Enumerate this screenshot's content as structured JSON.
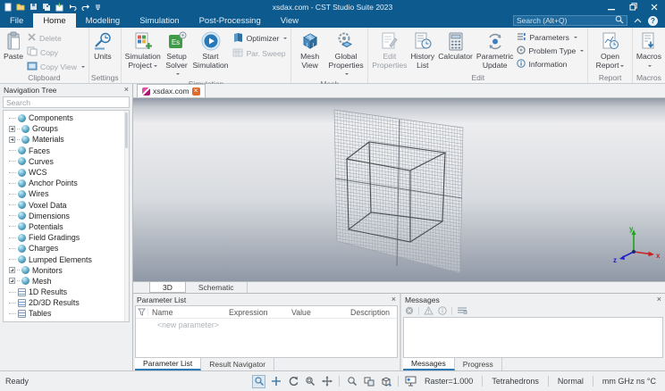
{
  "colors": {
    "titlebar_bg": "#0d5a8e",
    "ribbon_bg": "#f4f4f5",
    "accent_blue": "#2a7ab8",
    "active_tab_underline": "#2a7ab8",
    "axis_x": "#cc2020",
    "axis_y": "#18a818",
    "axis_z": "#2020cc",
    "doc_icon_pink": "#c4137f",
    "tab_close_orange": "#e06a2b"
  },
  "icons": {
    "close": "×",
    "help": "?",
    "solver_glyph": "Es"
  },
  "titlebar": {
    "title": "xsdax.com - CST Studio Suite 2023",
    "search_placeholder": "Search (Alt+Q)"
  },
  "menu": {
    "items": [
      {
        "label": "File"
      },
      {
        "label": "Home"
      },
      {
        "label": "Modeling"
      },
      {
        "label": "Simulation"
      },
      {
        "label": "Post-Processing"
      },
      {
        "label": "View"
      }
    ]
  },
  "ribbon": {
    "clipboard": {
      "label": "Clipboard",
      "paste": "Paste",
      "delete": "Delete",
      "copy": "Copy",
      "copy_view": "Copy View"
    },
    "settings": {
      "label": "Settings",
      "units": "Units"
    },
    "simulation": {
      "label": "Simulation",
      "project": "Simulation Project",
      "solver": "Setup Solver",
      "start": "Start Simulation",
      "optimizer": "Optimizer",
      "par_sweep": "Par. Sweep"
    },
    "mesh": {
      "label": "Mesh",
      "mesh_view": "Mesh View",
      "global_properties": "Global Properties"
    },
    "edit": {
      "label": "Edit",
      "edit_properties": "Edit Properties",
      "history_list": "History List",
      "calculator": "Calculator",
      "parametric_update": "Parametric Update",
      "parameters": "Parameters",
      "problem_type": "Problem Type",
      "information": "Information"
    },
    "report": {
      "label": "Report",
      "open_report": "Open Report"
    },
    "macros": {
      "label": "Macros",
      "macros": "Macros"
    }
  },
  "nav_tree": {
    "title": "Navigation Tree",
    "search_placeholder": "Search",
    "items": [
      {
        "label": "Components",
        "expandable": false
      },
      {
        "label": "Groups",
        "expandable": true
      },
      {
        "label": "Materials",
        "expandable": true
      },
      {
        "label": "Faces",
        "expandable": false
      },
      {
        "label": "Curves",
        "expandable": false
      },
      {
        "label": "WCS",
        "expandable": false
      },
      {
        "label": "Anchor Points",
        "expandable": false
      },
      {
        "label": "Wires",
        "expandable": false
      },
      {
        "label": "Voxel Data",
        "expandable": false
      },
      {
        "label": "Dimensions",
        "expandable": false
      },
      {
        "label": "Potentials",
        "expandable": false
      },
      {
        "label": "Field Gradings",
        "expandable": false
      },
      {
        "label": "Charges",
        "expandable": false
      },
      {
        "label": "Lumped Elements",
        "expandable": false
      },
      {
        "label": "Monitors",
        "expandable": true
      },
      {
        "label": "Mesh",
        "expandable": true
      },
      {
        "label": "1D Results",
        "expandable": false
      },
      {
        "label": "2D/3D Results",
        "expandable": false
      },
      {
        "label": "Tables",
        "expandable": false
      }
    ]
  },
  "document": {
    "tab_label": "xsdax.com"
  },
  "viewport": {
    "tabs": [
      {
        "label": "3D"
      },
      {
        "label": "Schematic"
      }
    ],
    "axes": {
      "x": "x",
      "y": "y",
      "z": "z"
    }
  },
  "parameter_list": {
    "title": "Parameter List",
    "columns": [
      "Name",
      "Expression",
      "Value",
      "Description"
    ],
    "new_parameter_row": "<new parameter>",
    "tabs": [
      {
        "label": "Parameter List"
      },
      {
        "label": "Result Navigator"
      }
    ]
  },
  "messages": {
    "title": "Messages",
    "tabs": [
      {
        "label": "Messages"
      },
      {
        "label": "Progress"
      }
    ]
  },
  "statusbar": {
    "ready": "Ready",
    "raster": "Raster=1.000",
    "mesh_type": "Tetrahedrons",
    "quality": "Normal",
    "units": "mm GHz ns °C"
  }
}
